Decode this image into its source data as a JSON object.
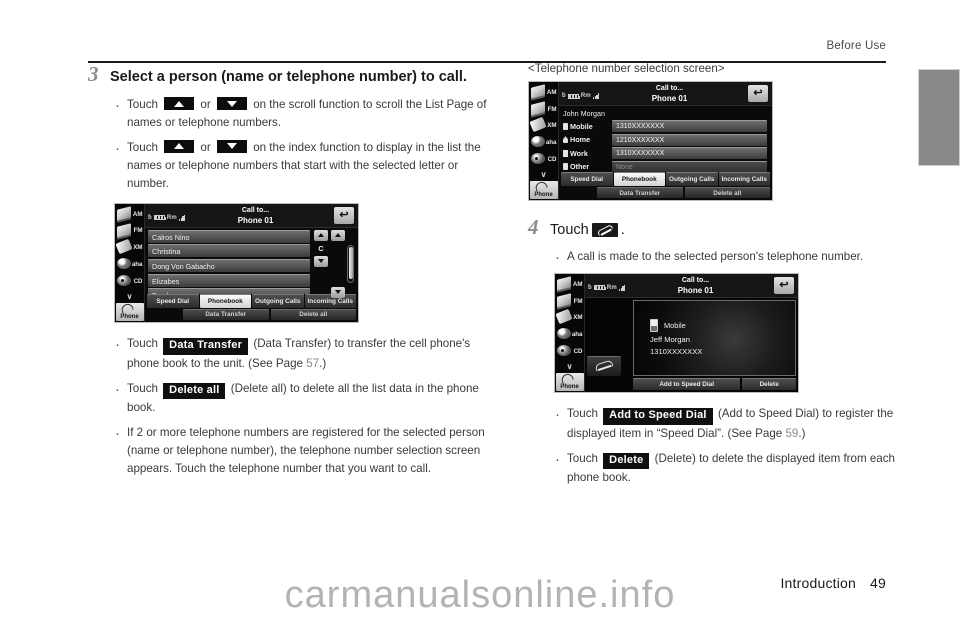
{
  "header": {
    "title": "Before Use"
  },
  "footer": {
    "section": "Introduction",
    "page_number": "49",
    "watermark": "carmanualsonline.info"
  },
  "left_column": {
    "step": {
      "number": "3",
      "title": "Select a person (name or telephone number) to call."
    },
    "bullets": [
      {
        "pre": "Touch",
        "mid": "or",
        "post": "on the scroll function to scroll the List Page of names or telephone numbers."
      },
      {
        "pre": "Touch",
        "mid": "or",
        "post": "on the index function to display in the list the names or telephone numbers that start with the selected letter or number."
      }
    ],
    "notes": [
      {
        "pre": "Touch",
        "chip": "Data Transfer",
        "post": "(Data Transfer) to transfer the cell phone's phone book to the unit. (See Page",
        "pageref": "57",
        "tail": ".)"
      },
      {
        "pre": "Touch",
        "chip": "Delete all",
        "post": "(Delete all) to delete all the list data in the phone book.",
        "pageref": "",
        "tail": ""
      },
      {
        "text": "If 2 or more telephone numbers are registered for the selected person (name or telephone number), the telephone number selection screen appears. Touch the telephone number that you want to call."
      }
    ]
  },
  "right_column": {
    "caption": "<Telephone number selection screen>",
    "step": {
      "number": "4",
      "pre": "Touch",
      "post": "."
    },
    "bullet": "A call is made to the selected person's telephone number.",
    "notes": [
      {
        "pre": "Touch",
        "chip": "Add to Speed Dial",
        "post": "(Add to Speed Dial) to register the displayed item in “Speed Dial”. (See Page",
        "pageref": "59",
        "tail": ".)"
      },
      {
        "pre": "Touch",
        "chip": "Delete",
        "post": "(Delete) to delete the displayed item from each phone book.",
        "pageref": "",
        "tail": ""
      }
    ]
  },
  "device_sidebar": {
    "items": [
      {
        "label": "AM",
        "icon": "radio-card-icon"
      },
      {
        "label": "FM",
        "icon": "radio-card-icon"
      },
      {
        "label": "XM",
        "icon": "antenna-wand-icon"
      },
      {
        "label": "aha",
        "icon": "aha-dot-icon"
      },
      {
        "label": "CD",
        "icon": "cd-disc-icon"
      }
    ],
    "chevron": "∨",
    "phone_label": "Phone"
  },
  "device_titlebar": {
    "title": "Call to...",
    "subtitle": "Phone 01",
    "back_icon": "↩",
    "status": {
      "bluetooth": "ƀ",
      "roaming": "Rm"
    }
  },
  "phonebook_screen": {
    "list": [
      "Calros Nino",
      "Christina",
      "Dong Von Gabacho",
      "Elizabes",
      "Frank"
    ],
    "index_letter": "C",
    "tabs": [
      {
        "label": "Speed Dial",
        "active": false
      },
      {
        "label": "Phonebook",
        "active": true
      },
      {
        "label": "Outgoing Calls",
        "active": false
      },
      {
        "label": "Incoming Calls",
        "active": false
      }
    ],
    "actions": [
      "Data Transfer",
      "Delete all"
    ]
  },
  "number_selection_screen": {
    "contact_name": "John Morgan",
    "rows": [
      {
        "label": "Mobile",
        "value": "1310XXXXXXX",
        "empty": false
      },
      {
        "label": "Home",
        "value": "1210XXXXXXX",
        "empty": false
      },
      {
        "label": "Work",
        "value": "1310XXXXXXX",
        "empty": false
      },
      {
        "label": "Other",
        "value": "None",
        "empty": true
      }
    ],
    "tabs": [
      {
        "label": "Speed Dial",
        "active": false
      },
      {
        "label": "Phonebook",
        "active": true
      },
      {
        "label": "Outgoing Calls",
        "active": false
      },
      {
        "label": "Incoming Calls",
        "active": false
      }
    ],
    "actions": [
      "Data Transfer",
      "Delete all"
    ]
  },
  "call_screen": {
    "type_label": "Mobile",
    "contact_name": "Jeff Morgan",
    "number": "1310XXXXXXX",
    "actions": [
      "Add to Speed Dial",
      "Delete"
    ]
  }
}
